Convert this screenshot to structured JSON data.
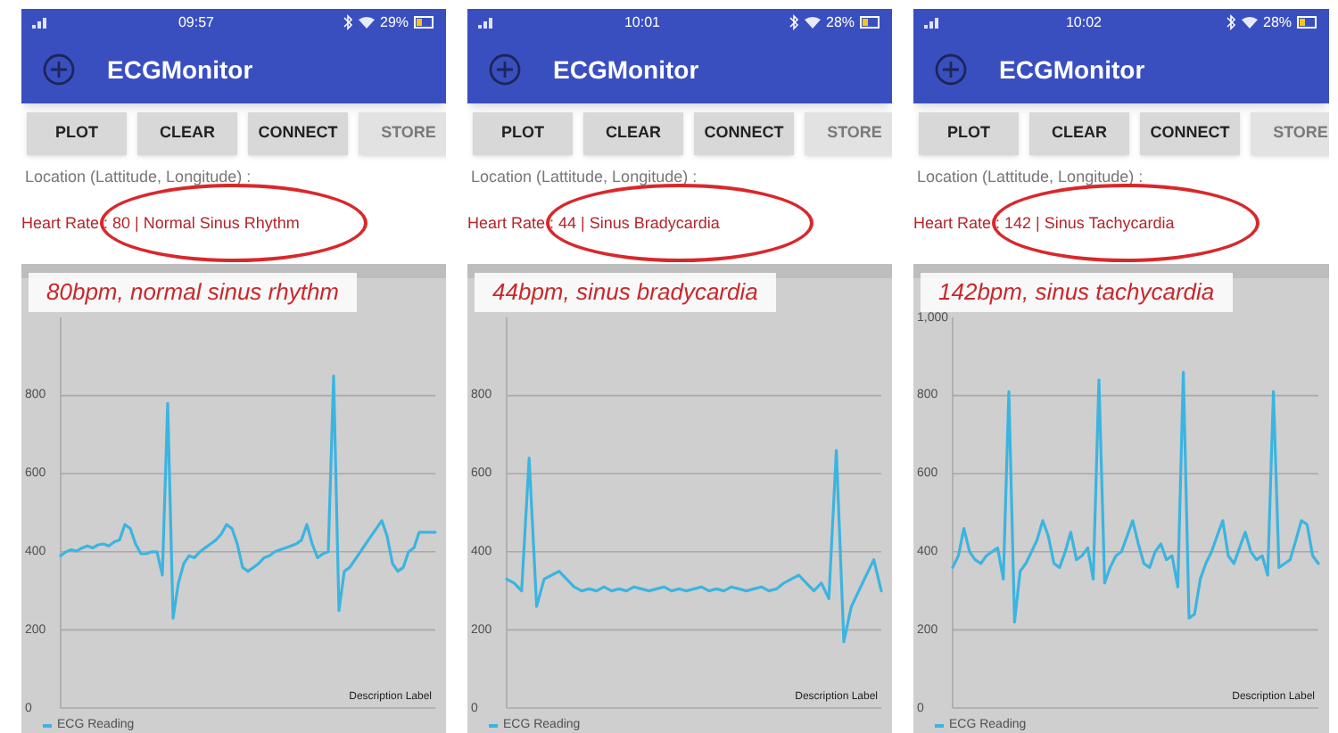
{
  "panels": [
    {
      "status_bar": {
        "time": "09:57",
        "battery": "29%"
      },
      "app_title": "ECGMonitor",
      "buttons": [
        {
          "label": "PLOT",
          "disabled": false
        },
        {
          "label": "CLEAR",
          "disabled": false
        },
        {
          "label": "CONNECT",
          "disabled": false
        },
        {
          "label": "STORE",
          "disabled": true
        }
      ],
      "location_label": "Location (Lattitude, Longitude) :",
      "heart_rate": "Heart Rate : 80 | Normal Sinus Rhythm",
      "annotation": "80bpm, normal sinus rhythm",
      "chart": {
        "description": "Description Label",
        "chart_data": {
          "type": "line",
          "grid": true,
          "ylim": [
            0,
            1000
          ],
          "yticks": [
            0,
            200,
            400,
            600,
            800
          ],
          "series": [
            {
              "name": "ECG Reading",
              "color": "#3cb4e0",
              "values": [
                390,
                400,
                405,
                402,
                410,
                415,
                410,
                418,
                420,
                415,
                425,
                430,
                470,
                460,
                420,
                395,
                395,
                400,
                400,
                340,
                780,
                230,
                320,
                370,
                390,
                385,
                400,
                410,
                420,
                430,
                445,
                470,
                460,
                420,
                360,
                350,
                360,
                370,
                385,
                390,
                400,
                405,
                410,
                415,
                420,
                430,
                470,
                420,
                385,
                395,
                400,
                850,
                250,
                350,
                360,
                380,
                400,
                420,
                440,
                460,
                480,
                440,
                370,
                350,
                360,
                400,
                410,
                450,
                450,
                450,
                450
              ]
            }
          ]
        }
      }
    },
    {
      "status_bar": {
        "time": "10:01",
        "battery": "28%"
      },
      "app_title": "ECGMonitor",
      "buttons": [
        {
          "label": "PLOT",
          "disabled": false
        },
        {
          "label": "CLEAR",
          "disabled": false
        },
        {
          "label": "CONNECT",
          "disabled": false
        },
        {
          "label": "STORE",
          "disabled": true
        }
      ],
      "location_label": "Location (Lattitude, Longitude) :",
      "heart_rate": "Heart Rate : 44 | Sinus Bradycardia",
      "annotation": "44bpm, sinus bradycardia",
      "chart": {
        "description": "Description Label",
        "chart_data": {
          "type": "line",
          "grid": true,
          "ylim": [
            0,
            1000
          ],
          "yticks": [
            0,
            200,
            400,
            600,
            800
          ],
          "series": [
            {
              "name": "ECG Reading",
              "color": "#3cb4e0",
              "values": [
                330,
                320,
                300,
                640,
                260,
                330,
                340,
                350,
                330,
                310,
                300,
                305,
                300,
                310,
                300,
                305,
                300,
                310,
                305,
                300,
                305,
                310,
                300,
                305,
                300,
                305,
                310,
                300,
                305,
                300,
                310,
                305,
                300,
                305,
                310,
                300,
                305,
                320,
                330,
                340,
                320,
                300,
                320,
                280,
                660,
                170,
                260,
                300,
                340,
                380,
                300
              ]
            }
          ]
        }
      }
    },
    {
      "status_bar": {
        "time": "10:02",
        "battery": "28%"
      },
      "app_title": "ECGMonitor",
      "buttons": [
        {
          "label": "PLOT",
          "disabled": false
        },
        {
          "label": "CLEAR",
          "disabled": false
        },
        {
          "label": "CONNECT",
          "disabled": false
        },
        {
          "label": "STORE",
          "disabled": true
        }
      ],
      "location_label": "Location (Lattitude, Longitude) :",
      "heart_rate": "Heart Rate : 142 | Sinus Tachycardia",
      "annotation": "142bpm, sinus tachycardia",
      "chart": {
        "description": "Description Label",
        "chart_data": {
          "type": "line",
          "grid": true,
          "ylim": [
            0,
            1000
          ],
          "yticks": [
            0,
            200,
            400,
            600,
            800,
            {
              "value": 1000,
              "label": "1,000"
            }
          ],
          "series": [
            {
              "name": "ECG Reading",
              "color": "#3cb4e0",
              "values": [
                360,
                390,
                460,
                400,
                380,
                370,
                390,
                400,
                410,
                330,
                810,
                220,
                350,
                370,
                400,
                430,
                480,
                440,
                370,
                360,
                400,
                450,
                380,
                390,
                410,
                330,
                840,
                320,
                360,
                390,
                400,
                440,
                480,
                420,
                370,
                360,
                400,
                420,
                380,
                390,
                310,
                860,
                230,
                240,
                330,
                370,
                400,
                440,
                480,
                390,
                370,
                410,
                450,
                400,
                380,
                390,
                340,
                810,
                360,
                370,
                380,
                430,
                480,
                470,
                390,
                370
              ]
            }
          ]
        }
      }
    }
  ]
}
